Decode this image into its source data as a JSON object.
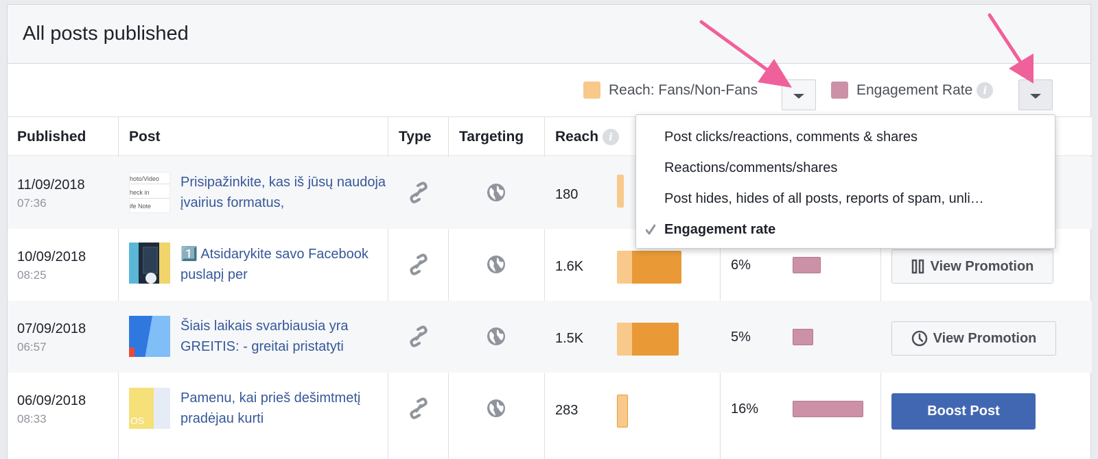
{
  "panel": {
    "title": "All posts published"
  },
  "metrics": {
    "reach": {
      "label": "Reach: Fans/Non-Fans",
      "color": "#f8c98a"
    },
    "engagement": {
      "label": "Engagement Rate",
      "color": "#cc91a7",
      "info_icon": "info-icon"
    }
  },
  "table": {
    "headers": {
      "published": "Published",
      "post": "Post",
      "type": "Type",
      "targeting": "Targeting",
      "reach": "Reach"
    },
    "rows": [
      {
        "date": "11/09/2018",
        "time": "07:36",
        "post_text": "Prisipažinkite, kas iš jūsų naudoja įvairius formatus,",
        "type_icon": "link-icon",
        "targeting_icon": "globe-icon",
        "reach": "180",
        "engagement": ""
      },
      {
        "date": "10/09/2018",
        "time": "08:25",
        "post_text": "1️⃣ Atsidarykite savo Facebook puslapį per",
        "type_icon": "link-icon",
        "targeting_icon": "globe-icon",
        "reach": "1.6K",
        "engagement": "6%",
        "engagement_fraction": 0.35,
        "action": "View Promotion",
        "action_icon": "pause-icon"
      },
      {
        "date": "07/09/2018",
        "time": "06:57",
        "post_text": "Šiais laikais svarbiausia yra GREITIS: - greitai pristatyti",
        "type_icon": "link-icon",
        "targeting_icon": "globe-icon",
        "reach": "1.5K",
        "engagement": "5%",
        "engagement_fraction": 0.27,
        "action": "View Promotion",
        "action_icon": "clock-icon"
      },
      {
        "date": "06/09/2018",
        "time": "08:33",
        "post_text": "Pamenu, kai prieš dešimtmetį pradėjau kurti",
        "type_icon": "link-icon",
        "targeting_icon": "globe-icon",
        "reach": "283",
        "engagement": "16%",
        "engagement_fraction": 0.95,
        "action": "Boost Post"
      }
    ]
  },
  "dropdown": {
    "items": [
      {
        "label": "Post clicks/reactions, comments & shares",
        "selected": false
      },
      {
        "label": "Reactions/comments/shares",
        "selected": false
      },
      {
        "label": "Post hides, hides of all posts, reports of spam, unli…",
        "selected": false
      },
      {
        "label": "Engagement rate",
        "selected": true
      }
    ]
  },
  "annotations": {
    "arrow_color": "#f0609a"
  }
}
